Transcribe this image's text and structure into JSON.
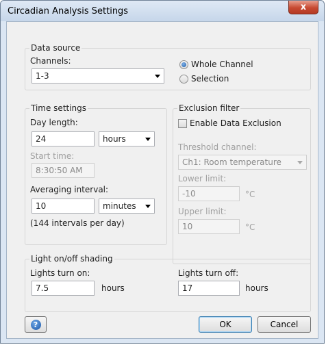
{
  "window": {
    "title": "Circadian Analysis Settings",
    "close_label": "x"
  },
  "data_source": {
    "group_label": "Data source",
    "channels_label": "Channels:",
    "channels_value": "1-3",
    "whole_channel_label": "Whole Channel",
    "selection_label": "Selection",
    "selected_option": "Whole Channel"
  },
  "time_settings": {
    "group_label": "Time settings",
    "day_length_label": "Day length:",
    "day_length_value": "24",
    "day_length_unit": "hours",
    "start_time_label": "Start time:",
    "start_time_value": "8:30:50 AM",
    "averaging_label": "Averaging interval:",
    "averaging_value": "10",
    "averaging_unit": "minutes",
    "intervals_note": "(144 intervals per day)"
  },
  "exclusion_filter": {
    "group_label": "Exclusion filter",
    "enable_label": "Enable Data Exclusion",
    "enabled": false,
    "threshold_label": "Threshold channel:",
    "threshold_value": "Ch1: Room temperature",
    "lower_label": "Lower limit:",
    "lower_value": "-10",
    "upper_label": "Upper limit:",
    "upper_value": "10",
    "unit": "°C"
  },
  "shading": {
    "group_label": "Light on/off shading",
    "on_label": "Lights turn on:",
    "on_value": "7.5",
    "off_label": "Lights turn off:",
    "off_value": "17",
    "unit": "hours"
  },
  "buttons": {
    "ok": "OK",
    "cancel": "Cancel",
    "help_glyph": "?"
  }
}
